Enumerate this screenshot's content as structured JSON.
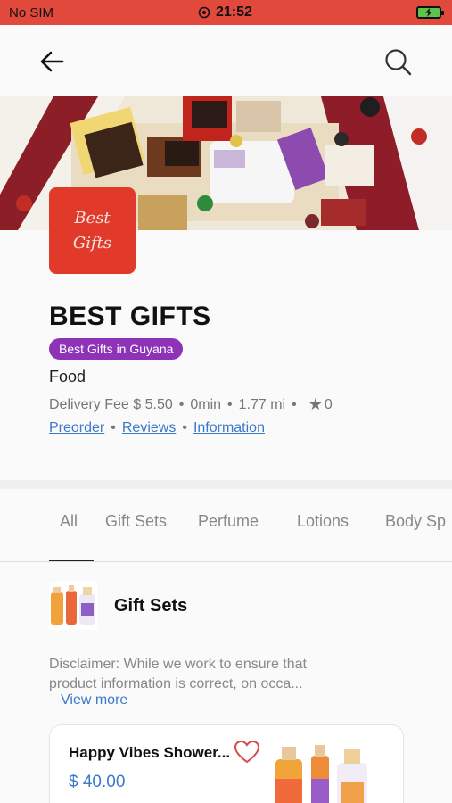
{
  "status_bar": {
    "carrier": "No SIM",
    "time": "21:52"
  },
  "store": {
    "name": "BEST GIFTS",
    "badge": "Best Gifts in Guyana",
    "category": "Food",
    "logo_line1": "Best",
    "logo_line2": "Gifts",
    "delivery_fee": "Delivery Fee $ 5.50",
    "delivery_time": "0min",
    "distance": "1.77 mi",
    "rating": "0"
  },
  "links": {
    "preorder": "Preorder",
    "reviews": "Reviews",
    "information": "Information"
  },
  "tabs": [
    "All",
    "Gift Sets",
    "Perfume",
    "Lotions",
    "Body Sp"
  ],
  "category": {
    "title": "Gift Sets",
    "disclaimer_line1": "Disclaimer: While we work to ensure that",
    "disclaimer_line2": "product information is correct, on occa...",
    "view_more": "View more"
  },
  "product": {
    "name": "Happy Vibes Shower...",
    "price": "$ 40.00"
  },
  "colors": {
    "status_bar": "#e2493d",
    "accent_blue": "#3b79c9",
    "badge_purple": "#8e32b8",
    "logo_red": "#e23a2a",
    "heart_red": "#d94a4a"
  },
  "icons": {
    "back": "arrow-left-icon",
    "search": "search-icon",
    "star": "star-icon",
    "heart": "heart-icon",
    "alarm": "alarm-icon",
    "battery": "battery-charging-icon"
  }
}
